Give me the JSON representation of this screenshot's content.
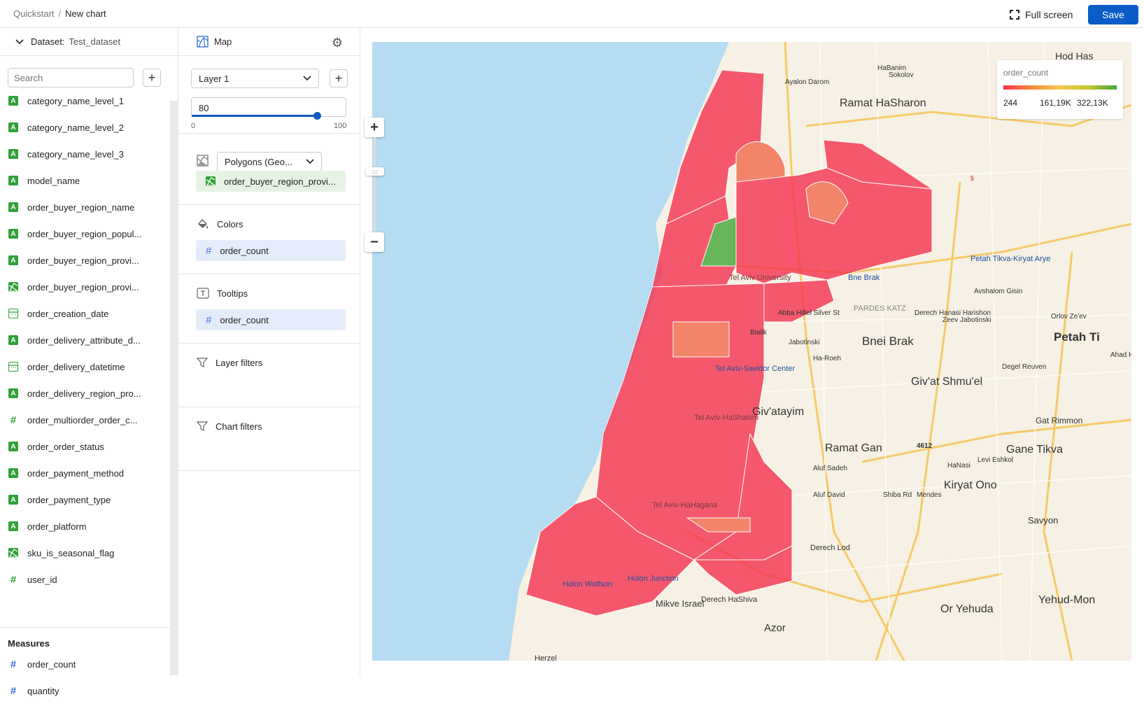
{
  "breadcrumb": {
    "root": "Quickstart",
    "current": "New chart"
  },
  "toolbar": {
    "fullscreen_label": "Full screen",
    "save_label": "Save"
  },
  "dataset": {
    "label": "Dataset:",
    "name": "Test_dataset",
    "search_placeholder": "Search",
    "dimensions": [
      {
        "type": "A",
        "name": "category_name_level_1"
      },
      {
        "type": "A",
        "name": "category_name_level_2"
      },
      {
        "type": "A",
        "name": "category_name_level_3"
      },
      {
        "type": "A",
        "name": "model_name"
      },
      {
        "type": "A",
        "name": "order_buyer_region_name"
      },
      {
        "type": "A",
        "name": "order_buyer_region_popul..."
      },
      {
        "type": "A",
        "name": "order_buyer_region_provi..."
      },
      {
        "type": "geo",
        "name": "order_buyer_region_provi..."
      },
      {
        "type": "date",
        "name": "order_creation_date"
      },
      {
        "type": "A",
        "name": "order_delivery_attribute_d..."
      },
      {
        "type": "date",
        "name": "order_delivery_datetime"
      },
      {
        "type": "A",
        "name": "order_delivery_region_pro..."
      },
      {
        "type": "hash",
        "name": "order_multiorder_order_c..."
      },
      {
        "type": "A",
        "name": "order_order_status"
      },
      {
        "type": "A",
        "name": "order_payment_method"
      },
      {
        "type": "A",
        "name": "order_payment_type"
      },
      {
        "type": "A",
        "name": "order_platform"
      },
      {
        "type": "geo",
        "name": "sku_is_seasonal_flag"
      },
      {
        "type": "hash",
        "name": "user_id"
      }
    ],
    "measures_title": "Measures",
    "measures": [
      {
        "type": "hash",
        "name": "order_count"
      },
      {
        "type": "hash",
        "name": "quantity"
      }
    ]
  },
  "settings": {
    "chart_type": "Map",
    "layer": "Layer 1",
    "opacity": "80",
    "slider_min": "0",
    "slider_max": "100",
    "opacity_fraction": 0.8,
    "geo_type": "Polygons (Geo...",
    "geo_field": "order_buyer_region_provi...",
    "colors_title": "Colors",
    "colors_field": "order_count",
    "tooltips_title": "Tooltips",
    "tooltips_field": "order_count",
    "layer_filters_title": "Layer filters",
    "chart_filters_title": "Chart filters"
  },
  "legend": {
    "title": "order_count",
    "min": "244",
    "mid": "161,19K",
    "max": "322,13K"
  },
  "map_labels": [
    "Ramat HaSharon",
    "Bnei Brak",
    "Bne Brak",
    "PARDES KATZ",
    "Giv'at Shmu'el",
    "Giv'atayim",
    "Ramat Gan",
    "Gane Tikva",
    "Kiryat Ono",
    "Or Yehuda",
    "Yehud-Mon",
    "Savyon",
    "Azor",
    "Mikve Israel",
    "Holon Junction",
    "Holon Wolfson",
    "Tel Aviv-Savidor Center",
    "Petah Tikva-Kiryat Arye",
    "Gat Rimmon",
    "Petah Ti",
    "Hod Has",
    "Herzel",
    "Zeev Jabotinski",
    "Derech HaShiva",
    "Derech Lod",
    "Aluf Sadeh",
    "Aluf David",
    "Avshalom Gisin",
    "Orlov Ze'ev",
    "Degel Reuven",
    "Ha-Roeh",
    "Jabotinski",
    "Bialik",
    "Ayalon Darom",
    "Sokolov",
    "HaBanim",
    "Derech Hanasi Harishon",
    "Abba Hillel Silver St",
    "Shiba Rd",
    "Mendes",
    "HaNasi",
    "Levi Eshkol",
    "Ahad H",
    "4612",
    "5",
    "Tel Aviv University",
    "Tel Aviv-HaHagana",
    "Tel Aviv-HaShalom"
  ],
  "colors": {
    "accent": "#0a5cc8",
    "polygon_low": "#f5334f",
    "polygon_mid": "#f58b3c",
    "polygon_high": "#43a738",
    "water": "#b5dcf2",
    "land": "#f6f1e4"
  }
}
